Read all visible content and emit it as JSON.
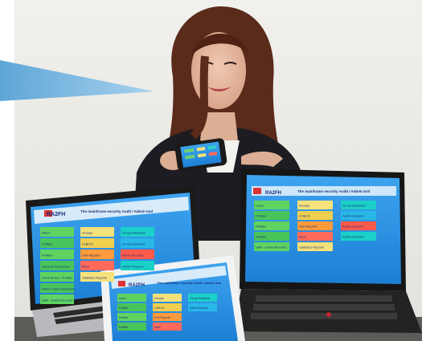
{
  "screens": {
    "brand": "RA2FH",
    "tagline": "The mainframe security Audit / Admin tool",
    "laptop_left": {
      "left_col": [
        "RACF",
        "Profiles",
        "Profiles",
        "General Resources",
        "General Res. Profiles",
        "RACF Class Descriptor",
        "SMF - Event Records"
      ],
      "mid_col": [
        "Groups",
        "CHECK",
        "Xref Reports",
        "More",
        "Statistics Reports"
      ],
      "right_col": [
        "Group Relations",
        "Group Relations",
        "Admin Reports",
        "Admin Reports"
      ]
    },
    "laptop_right": {
      "left_col": [
        "Users",
        "Profiles",
        "Profiles",
        "Profiles",
        "SMF - Event Records"
      ],
      "mid_col": [
        "Groups",
        "CHECK",
        "Xref Reports",
        "More",
        "Statistics Reports"
      ],
      "right_col": [
        "Group Relations",
        "Admin Reports",
        "Admin Reports",
        "Admin Reports"
      ]
    },
    "tablet": {
      "left_col": [
        "Users",
        "Profiles",
        "Profiles",
        "Profiles"
      ],
      "mid_col": [
        "Groups",
        "CHECK",
        "Xref Reports",
        "More"
      ],
      "right_col": [
        "Group Relations",
        "Admin Reports"
      ]
    }
  },
  "colors": {
    "wall": "#ecebe6",
    "screen_blue": "#2a8fe0",
    "callout": "#79b6dd",
    "hair": "#5a2a1a"
  }
}
